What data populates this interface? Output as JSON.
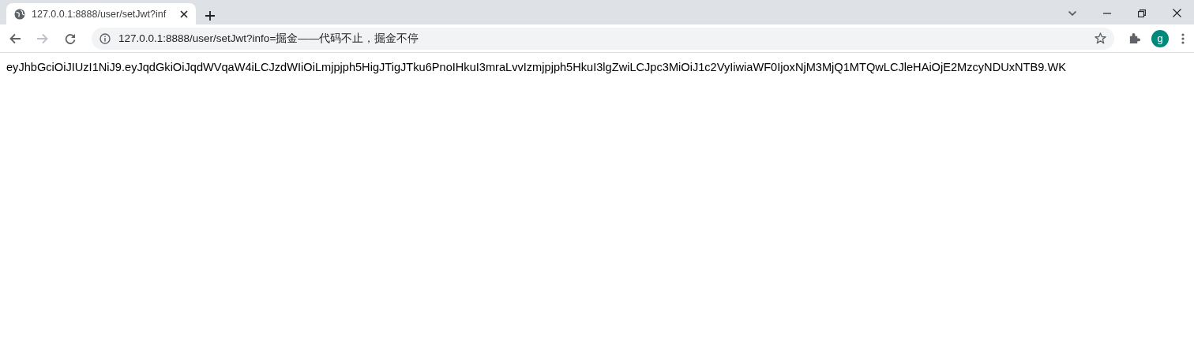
{
  "tab": {
    "title": "127.0.0.1:8888/user/setJwt?inf",
    "selected": true
  },
  "address_bar": {
    "value": "127.0.0.1:8888/user/setJwt?info=掘金——代码不止，掘金不停"
  },
  "profile": {
    "initial": "g",
    "color": "#00897b"
  },
  "page": {
    "text": "eyJhbGciOiJIUzI1NiJ9.eyJqdGkiOiJqdWVqaW4iLCJzdWIiOiLmjpjph5HigJTigJTku6PnoIHkuI3mraLvvIzmjpjph5HkuI3lgZwiLCJpc3MiOiJ1c2VyIiwiaWF0IjoxNjM3MjQ1MTQwLCJleHAiOjE2MzcyNDUxNTB9.WK"
  }
}
